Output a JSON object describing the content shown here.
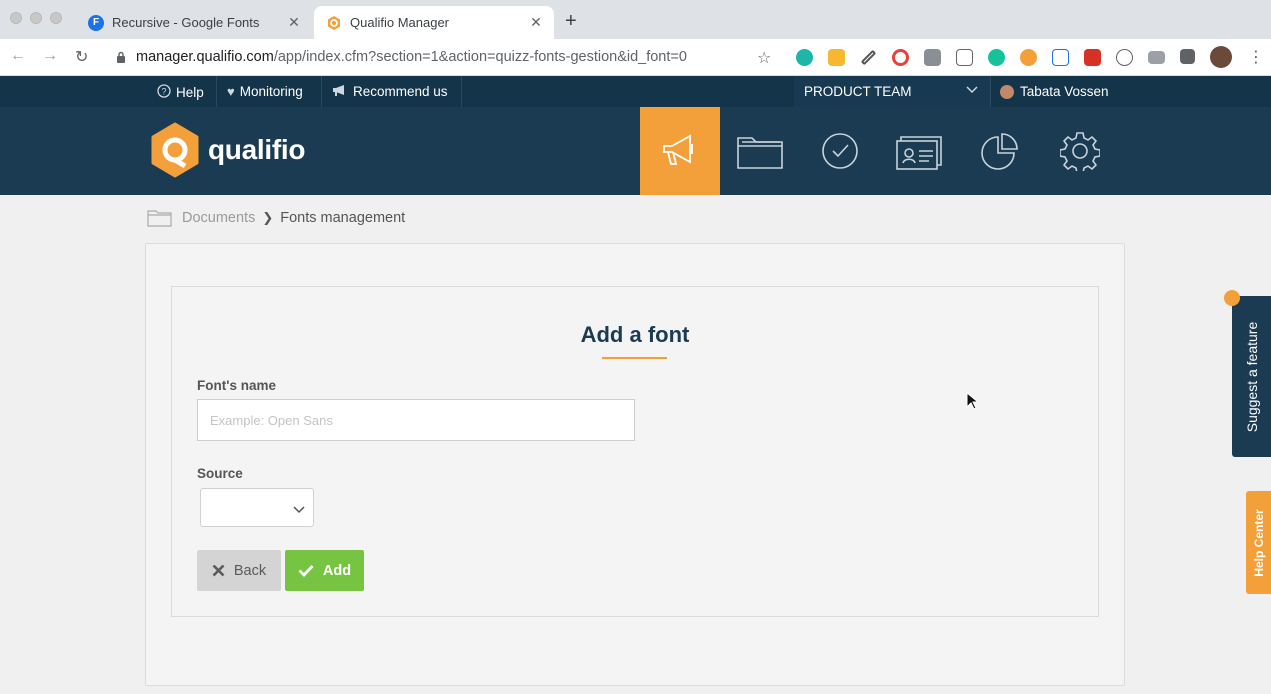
{
  "browser": {
    "tabs": [
      {
        "title": "Recursive - Google Fonts",
        "favicon_letter": "F",
        "favicon_color": "#1a73e8",
        "active": false
      },
      {
        "title": "Qualifio Manager",
        "favicon_letter": "",
        "favicon_color": "#f4a03a",
        "active": true
      }
    ],
    "url_host": "manager.qualifio.com",
    "url_path": "/app/index.cfm?section=1&action=quizz-fonts-gestion&id_font=0"
  },
  "topbar": {
    "help": "Help",
    "monitoring": "Monitoring",
    "recommend": "Recommend us",
    "team": "PRODUCT TEAM",
    "user": "Tabata Vossen"
  },
  "header": {
    "logo_text": "qualifio",
    "nav_icons": [
      "megaphone-icon",
      "folder-icon",
      "check-circle-icon",
      "contacts-icon",
      "pie-chart-icon",
      "gear-icon"
    ],
    "active_index": 0
  },
  "breadcrumb": {
    "parent": "Documents",
    "current": "Fonts management"
  },
  "form": {
    "title": "Add a font",
    "name_label": "Font's name",
    "name_placeholder": "Example: Open Sans",
    "name_value": "",
    "source_label": "Source",
    "source_value": "",
    "back_label": "Back",
    "add_label": "Add"
  },
  "widgets": {
    "suggest": "Suggest a feature",
    "help_center": "Help Center"
  },
  "colors": {
    "navy": "#14344a",
    "header": "#1b3b52",
    "accent_orange": "#f4a03a",
    "add_green": "#77c442"
  }
}
